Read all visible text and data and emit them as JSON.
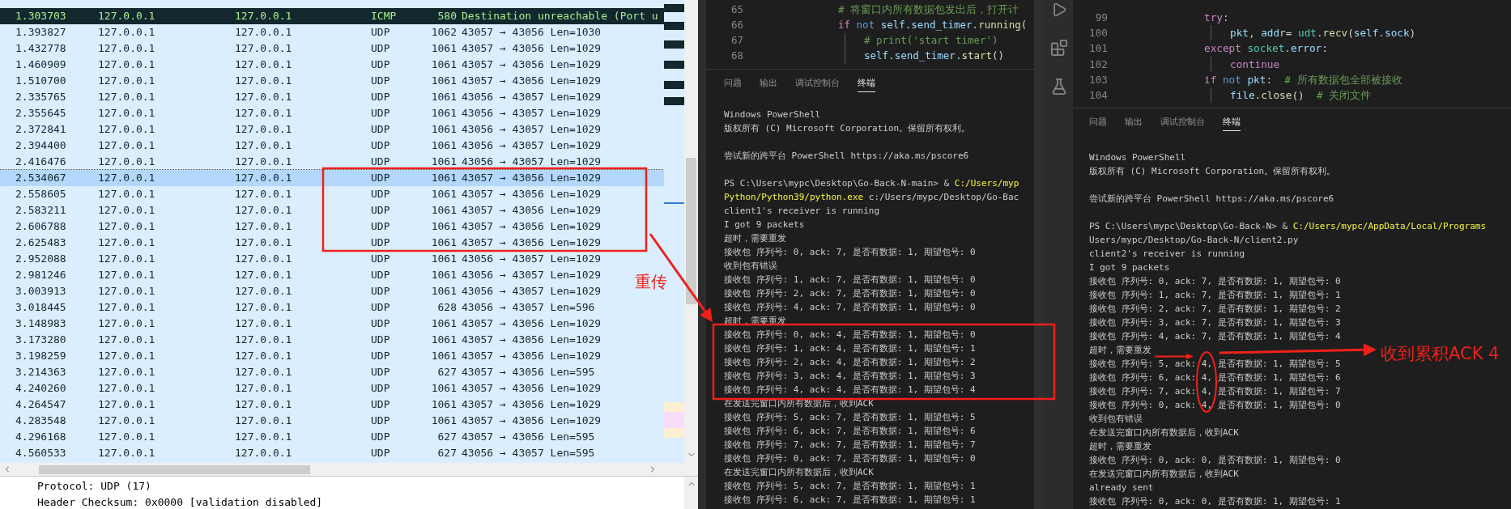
{
  "packet_list": {
    "rows": [
      {
        "time": "1.303703",
        "source": "127.0.0.1",
        "destination": "127.0.0.1",
        "protocol": "ICMP",
        "length": "580",
        "info": "Destination unreachable (Port u",
        "kind": "error",
        "selected": false
      },
      {
        "time": "1.393827",
        "source": "127.0.0.1",
        "destination": "127.0.0.1",
        "protocol": "UDP",
        "length": "1062",
        "info": "43057 → 43056 Len=1030",
        "kind": "normal",
        "selected": false
      },
      {
        "time": "1.432778",
        "source": "127.0.0.1",
        "destination": "127.0.0.1",
        "protocol": "UDP",
        "length": "1061",
        "info": "43057 → 43056 Len=1029",
        "kind": "normal",
        "selected": false
      },
      {
        "time": "1.460909",
        "source": "127.0.0.1",
        "destination": "127.0.0.1",
        "protocol": "UDP",
        "length": "1061",
        "info": "43057 → 43056 Len=1029",
        "kind": "normal",
        "selected": false
      },
      {
        "time": "1.510700",
        "source": "127.0.0.1",
        "destination": "127.0.0.1",
        "protocol": "UDP",
        "length": "1061",
        "info": "43057 → 43056 Len=1029",
        "kind": "normal",
        "selected": false
      },
      {
        "time": "2.335765",
        "source": "127.0.0.1",
        "destination": "127.0.0.1",
        "protocol": "UDP",
        "length": "1061",
        "info": "43056 → 43057 Len=1029",
        "kind": "normal",
        "selected": false
      },
      {
        "time": "2.355645",
        "source": "127.0.0.1",
        "destination": "127.0.0.1",
        "protocol": "UDP",
        "length": "1061",
        "info": "43056 → 43057 Len=1029",
        "kind": "normal",
        "selected": false
      },
      {
        "time": "2.372841",
        "source": "127.0.0.1",
        "destination": "127.0.0.1",
        "protocol": "UDP",
        "length": "1061",
        "info": "43056 → 43057 Len=1029",
        "kind": "normal",
        "selected": false
      },
      {
        "time": "2.394400",
        "source": "127.0.0.1",
        "destination": "127.0.0.1",
        "protocol": "UDP",
        "length": "1061",
        "info": "43056 → 43057 Len=1029",
        "kind": "normal",
        "selected": false
      },
      {
        "time": "2.416476",
        "source": "127.0.0.1",
        "destination": "127.0.0.1",
        "protocol": "UDP",
        "length": "1061",
        "info": "43056 → 43057 Len=1029",
        "kind": "normal",
        "selected": false
      },
      {
        "time": "2.534067",
        "source": "127.0.0.1",
        "destination": "127.0.0.1",
        "protocol": "UDP",
        "length": "1061",
        "info": "43057 → 43056 Len=1029",
        "kind": "normal",
        "selected": true
      },
      {
        "time": "2.558605",
        "source": "127.0.0.1",
        "destination": "127.0.0.1",
        "protocol": "UDP",
        "length": "1061",
        "info": "43057 → 43056 Len=1029",
        "kind": "normal",
        "selected": false
      },
      {
        "time": "2.583211",
        "source": "127.0.0.1",
        "destination": "127.0.0.1",
        "protocol": "UDP",
        "length": "1061",
        "info": "43057 → 43056 Len=1029",
        "kind": "normal",
        "selected": false
      },
      {
        "time": "2.606788",
        "source": "127.0.0.1",
        "destination": "127.0.0.1",
        "protocol": "UDP",
        "length": "1061",
        "info": "43057 → 43056 Len=1029",
        "kind": "normal",
        "selected": false
      },
      {
        "time": "2.625483",
        "source": "127.0.0.1",
        "destination": "127.0.0.1",
        "protocol": "UDP",
        "length": "1061",
        "info": "43057 → 43056 Len=1029",
        "kind": "normal",
        "selected": false
      },
      {
        "time": "2.952088",
        "source": "127.0.0.1",
        "destination": "127.0.0.1",
        "protocol": "UDP",
        "length": "1061",
        "info": "43056 → 43057 Len=1029",
        "kind": "normal",
        "selected": false
      },
      {
        "time": "2.981246",
        "source": "127.0.0.1",
        "destination": "127.0.0.1",
        "protocol": "UDP",
        "length": "1061",
        "info": "43056 → 43057 Len=1029",
        "kind": "normal",
        "selected": false
      },
      {
        "time": "3.003913",
        "source": "127.0.0.1",
        "destination": "127.0.0.1",
        "protocol": "UDP",
        "length": "1061",
        "info": "43056 → 43057 Len=1029",
        "kind": "normal",
        "selected": false
      },
      {
        "time": "3.018445",
        "source": "127.0.0.1",
        "destination": "127.0.0.1",
        "protocol": "UDP",
        "length": "628",
        "info": "43056 → 43057 Len=596",
        "kind": "normal",
        "selected": false
      },
      {
        "time": "3.148983",
        "source": "127.0.0.1",
        "destination": "127.0.0.1",
        "protocol": "UDP",
        "length": "1061",
        "info": "43057 → 43056 Len=1029",
        "kind": "normal",
        "selected": false
      },
      {
        "time": "3.173280",
        "source": "127.0.0.1",
        "destination": "127.0.0.1",
        "protocol": "UDP",
        "length": "1061",
        "info": "43057 → 43056 Len=1029",
        "kind": "normal",
        "selected": false
      },
      {
        "time": "3.198259",
        "source": "127.0.0.1",
        "destination": "127.0.0.1",
        "protocol": "UDP",
        "length": "1061",
        "info": "43057 → 43056 Len=1029",
        "kind": "normal",
        "selected": false
      },
      {
        "time": "3.214363",
        "source": "127.0.0.1",
        "destination": "127.0.0.1",
        "protocol": "UDP",
        "length": "627",
        "info": "43057 → 43056 Len=595",
        "kind": "normal",
        "selected": false
      },
      {
        "time": "4.240260",
        "source": "127.0.0.1",
        "destination": "127.0.0.1",
        "protocol": "UDP",
        "length": "1061",
        "info": "43057 → 43056 Len=1029",
        "kind": "normal",
        "selected": false
      },
      {
        "time": "4.264547",
        "source": "127.0.0.1",
        "destination": "127.0.0.1",
        "protocol": "UDP",
        "length": "1061",
        "info": "43057 → 43056 Len=1029",
        "kind": "normal",
        "selected": false
      },
      {
        "time": "4.283548",
        "source": "127.0.0.1",
        "destination": "127.0.0.1",
        "protocol": "UDP",
        "length": "1061",
        "info": "43057 → 43056 Len=1029",
        "kind": "normal",
        "selected": false
      },
      {
        "time": "4.296168",
        "source": "127.0.0.1",
        "destination": "127.0.0.1",
        "protocol": "UDP",
        "length": "627",
        "info": "43057 → 43056 Len=595",
        "kind": "normal",
        "selected": false
      },
      {
        "time": "4.560533",
        "source": "127.0.0.1",
        "destination": "127.0.0.1",
        "protocol": "UDP",
        "length": "627",
        "info": "43056 → 43057 Len=595",
        "kind": "normal",
        "selected": false
      }
    ]
  },
  "packet_details": [
    "Protocol: UDP (17)",
    "Header Checksum: 0x0000 [validation disabled]"
  ],
  "editors": [
    {
      "code_lines": [
        {
          "number": "65",
          "indented": false,
          "tokens": [
            {
              "text": "# 将窗口内所有数据包发出后，打开计",
              "kind": "comment"
            }
          ]
        },
        {
          "number": "66",
          "indented": false,
          "tokens": [
            {
              "text": "if",
              "kind": "control"
            },
            {
              "text": " not ",
              "kind": "keyword"
            },
            {
              "text": "self.send_timer.",
              "kind": "variable"
            },
            {
              "text": "running",
              "kind": "function"
            },
            {
              "text": "(",
              "kind": "plain"
            }
          ]
        },
        {
          "number": "67",
          "indented": true,
          "tokens": [
            {
              "text": "# print('start timer')",
              "kind": "comment"
            }
          ]
        },
        {
          "number": "68",
          "indented": true,
          "tokens": [
            {
              "text": "self.send_timer.",
              "kind": "variable"
            },
            {
              "text": "start",
              "kind": "function"
            },
            {
              "text": "()",
              "kind": "plain"
            }
          ]
        }
      ],
      "tabs": [
        {
          "label": "问题",
          "selected": false
        },
        {
          "label": "输出",
          "selected": false
        },
        {
          "label": "调试控制台",
          "selected": false
        },
        {
          "label": "终端",
          "selected": true
        }
      ],
      "terminal": [
        {
          "kind": "text",
          "segments": [
            {
              "text": "Windows PowerShell",
              "highlight": false
            }
          ]
        },
        {
          "kind": "text",
          "segments": [
            {
              "text": "版权所有 (C) Microsoft Corporation。保留所有权利。",
              "highlight": false
            }
          ]
        },
        {
          "kind": "blank"
        },
        {
          "kind": "text",
          "segments": [
            {
              "text": "尝试新的跨平台 PowerShell https://aka.ms/pscore6",
              "highlight": false
            }
          ]
        },
        {
          "kind": "blank"
        },
        {
          "kind": "text",
          "segments": [
            {
              "text": "PS C:\\Users\\mypc\\Desktop\\Go-Back-N-main> & ",
              "highlight": false
            },
            {
              "text": "C:/Users/myp",
              "highlight": true
            }
          ]
        },
        {
          "kind": "text",
          "segments": [
            {
              "text": "Python/Python39/python.exe",
              "highlight": true
            },
            {
              "text": " c:/Users/mypc/Desktop/Go-Bac",
              "highlight": false
            }
          ]
        },
        {
          "kind": "text",
          "segments": [
            {
              "text": "client1's receiver is running",
              "highlight": false
            }
          ]
        },
        {
          "kind": "text",
          "segments": [
            {
              "text": "I got 9 packets",
              "highlight": false
            }
          ]
        },
        {
          "kind": "text",
          "segments": [
            {
              "text": "超时，需要重发",
              "highlight": false
            }
          ]
        },
        {
          "kind": "text",
          "segments": [
            {
              "text": "接收包 序列号: 0, ack: 7, 是否有数据: 1, 期望包号: 0",
              "highlight": false
            }
          ]
        },
        {
          "kind": "text",
          "segments": [
            {
              "text": "收到包有错误",
              "highlight": false
            }
          ]
        },
        {
          "kind": "text",
          "segments": [
            {
              "text": "接收包 序列号: 1, ack: 7, 是否有数据: 1, 期望包号: 0",
              "highlight": false
            }
          ]
        },
        {
          "kind": "text",
          "segments": [
            {
              "text": "接收包 序列号: 2, ack: 7, 是否有数据: 1, 期望包号: 0",
              "highlight": false
            }
          ]
        },
        {
          "kind": "text",
          "segments": [
            {
              "text": "接收包 序列号: 4, ack: 7, 是否有数据: 1, 期望包号: 0",
              "highlight": false
            }
          ]
        },
        {
          "kind": "text",
          "segments": [
            {
              "text": "超时，需要重发",
              "highlight": false
            }
          ]
        },
        {
          "kind": "text",
          "segments": [
            {
              "text": "接收包 序列号: 0, ack: 4, 是否有数据: 1, 期望包号: 0",
              "highlight": false
            }
          ]
        },
        {
          "kind": "text",
          "segments": [
            {
              "text": "接收包 序列号: 1, ack: 4, 是否有数据: 1, 期望包号: 1",
              "highlight": false
            }
          ]
        },
        {
          "kind": "text",
          "segments": [
            {
              "text": "接收包 序列号: 2, ack: 4, 是否有数据: 1, 期望包号: 2",
              "highlight": false
            }
          ]
        },
        {
          "kind": "text",
          "segments": [
            {
              "text": "接收包 序列号: 3, ack: 4, 是否有数据: 1, 期望包号: 3",
              "highlight": false
            }
          ]
        },
        {
          "kind": "text",
          "segments": [
            {
              "text": "接收包 序列号: 4, ack: 4, 是否有数据: 1, 期望包号: 4",
              "highlight": false
            }
          ]
        },
        {
          "kind": "text",
          "segments": [
            {
              "text": "在发送完窗口内所有数据后，收到ACK",
              "highlight": false
            }
          ]
        },
        {
          "kind": "text",
          "segments": [
            {
              "text": "接收包 序列号: 5, ack: 7, 是否有数据: 1, 期望包号: 5",
              "highlight": false
            }
          ]
        },
        {
          "kind": "text",
          "segments": [
            {
              "text": "接收包 序列号: 6, ack: 7, 是否有数据: 1, 期望包号: 6",
              "highlight": false
            }
          ]
        },
        {
          "kind": "text",
          "segments": [
            {
              "text": "接收包 序列号: 7, ack: 7, 是否有数据: 1, 期望包号: 7",
              "highlight": false
            }
          ]
        },
        {
          "kind": "text",
          "segments": [
            {
              "text": "接收包 序列号: 0, ack: 7, 是否有数据: 1, 期望包号: 0",
              "highlight": false
            }
          ]
        },
        {
          "kind": "text",
          "segments": [
            {
              "text": "在发送完窗口内所有数据后，收到ACK",
              "highlight": false
            }
          ]
        },
        {
          "kind": "text",
          "segments": [
            {
              "text": "接收包 序列号: 5, ack: 7, 是否有数据: 1, 期望包号: 1",
              "highlight": false
            }
          ]
        },
        {
          "kind": "text",
          "segments": [
            {
              "text": "接收包 序列号: 6, ack: 7, 是否有数据: 1, 期望包号: 1",
              "highlight": false
            }
          ]
        }
      ]
    },
    {
      "code_lines": [
        {
          "number": "99",
          "indented": false,
          "tokens": [
            {
              "text": "try",
              "kind": "control"
            },
            {
              "text": ":",
              "kind": "plain"
            }
          ]
        },
        {
          "number": "100",
          "indented": true,
          "tokens": [
            {
              "text": "pkt",
              "kind": "variable"
            },
            {
              "text": ", ",
              "kind": "plain"
            },
            {
              "text": "addr",
              "kind": "variable"
            },
            {
              "text": "= ",
              "kind": "plain"
            },
            {
              "text": "udt",
              "kind": "type"
            },
            {
              "text": ".",
              "kind": "plain"
            },
            {
              "text": "recv",
              "kind": "function"
            },
            {
              "text": "(",
              "kind": "plain"
            },
            {
              "text": "self.sock",
              "kind": "variable"
            },
            {
              "text": ")",
              "kind": "plain"
            }
          ]
        },
        {
          "number": "101",
          "indented": false,
          "tokens": [
            {
              "text": "except ",
              "kind": "control"
            },
            {
              "text": "socket",
              "kind": "type"
            },
            {
              "text": ".",
              "kind": "plain"
            },
            {
              "text": "error",
              "kind": "variable"
            },
            {
              "text": ":",
              "kind": "plain"
            }
          ]
        },
        {
          "number": "102",
          "indented": true,
          "tokens": [
            {
              "text": "continue",
              "kind": "control"
            }
          ]
        },
        {
          "number": "103",
          "indented": false,
          "tokens": [
            {
              "text": "if",
              "kind": "control"
            },
            {
              "text": " not ",
              "kind": "keyword"
            },
            {
              "text": "pkt",
              "kind": "variable"
            },
            {
              "text": ":  ",
              "kind": "plain"
            },
            {
              "text": "# 所有数据包全部被接收",
              "kind": "comment"
            }
          ]
        },
        {
          "number": "104",
          "indented": true,
          "tokens": [
            {
              "text": "file",
              "kind": "variable"
            },
            {
              "text": ".",
              "kind": "plain"
            },
            {
              "text": "close",
              "kind": "function"
            },
            {
              "text": "()  ",
              "kind": "plain"
            },
            {
              "text": "# 关闭文件",
              "kind": "comment"
            }
          ]
        }
      ],
      "tabs": [
        {
          "label": "问题",
          "selected": false
        },
        {
          "label": "输出",
          "selected": false
        },
        {
          "label": "调试控制台",
          "selected": false
        },
        {
          "label": "终端",
          "selected": true
        }
      ],
      "terminal": [
        {
          "kind": "text",
          "segments": [
            {
              "text": "Windows PowerShell",
              "highlight": false
            }
          ]
        },
        {
          "kind": "text",
          "segments": [
            {
              "text": "版权所有 (C) Microsoft Corporation。保留所有权利。",
              "highlight": false
            }
          ]
        },
        {
          "kind": "blank"
        },
        {
          "kind": "text",
          "segments": [
            {
              "text": "尝试新的跨平台 PowerShell https://aka.ms/pscore6",
              "highlight": false
            }
          ]
        },
        {
          "kind": "blank"
        },
        {
          "kind": "text",
          "segments": [
            {
              "text": "PS C:\\Users\\mypc\\Desktop\\Go-Back-N> & ",
              "highlight": false
            },
            {
              "text": "C:/Users/mypc/AppData/Local/Programs",
              "highlight": true
            }
          ]
        },
        {
          "kind": "text",
          "segments": [
            {
              "text": "Users/mypc/Desktop/Go-Back-N/client2.py",
              "highlight": false
            }
          ]
        },
        {
          "kind": "text",
          "segments": [
            {
              "text": "client2's receiver is running",
              "highlight": false
            }
          ]
        },
        {
          "kind": "text",
          "segments": [
            {
              "text": "I got 9 packets",
              "highlight": false
            }
          ]
        },
        {
          "kind": "text",
          "segments": [
            {
              "text": "接收包 序列号: 0, ack: 7, 是否有数据: 1, 期望包号: 0",
              "highlight": false
            }
          ]
        },
        {
          "kind": "text",
          "segments": [
            {
              "text": "接收包 序列号: 1, ack: 7, 是否有数据: 1, 期望包号: 1",
              "highlight": false
            }
          ]
        },
        {
          "kind": "text",
          "segments": [
            {
              "text": "接收包 序列号: 2, ack: 7, 是否有数据: 1, 期望包号: 2",
              "highlight": false
            }
          ]
        },
        {
          "kind": "text",
          "segments": [
            {
              "text": "接收包 序列号: 3, ack: 7, 是否有数据: 1, 期望包号: 3",
              "highlight": false
            }
          ]
        },
        {
          "kind": "text",
          "segments": [
            {
              "text": "接收包 序列号: 4, ack: 7, 是否有数据: 1, 期望包号: 4",
              "highlight": false
            }
          ]
        },
        {
          "kind": "text",
          "segments": [
            {
              "text": "超时，需要重发",
              "highlight": false
            }
          ]
        },
        {
          "kind": "text",
          "segments": [
            {
              "text": "接收包 序列号: 5, ack: 4, 是否有数据: 1, 期望包号: 5",
              "highlight": false
            }
          ]
        },
        {
          "kind": "text",
          "segments": [
            {
              "text": "接收包 序列号: 6, ack: 4, 是否有数据: 1, 期望包号: 6",
              "highlight": false
            }
          ]
        },
        {
          "kind": "text",
          "segments": [
            {
              "text": "接收包 序列号: 7, ack: 4, 是否有数据: 1, 期望包号: 7",
              "highlight": false
            }
          ]
        },
        {
          "kind": "text",
          "segments": [
            {
              "text": "接收包 序列号: 0, ack: 4, 是否有数据: 1, 期望包号: 0",
              "highlight": false
            }
          ]
        },
        {
          "kind": "text",
          "segments": [
            {
              "text": "收到包有错误",
              "highlight": false
            }
          ]
        },
        {
          "kind": "text",
          "segments": [
            {
              "text": "在发送完窗口内所有数据后，收到ACK",
              "highlight": false
            }
          ]
        },
        {
          "kind": "text",
          "segments": [
            {
              "text": "超时，需要重发",
              "highlight": false
            }
          ]
        },
        {
          "kind": "text",
          "segments": [
            {
              "text": "接收包 序列号: 0, ack: 0, 是否有数据: 1, 期望包号: 0",
              "highlight": false
            }
          ]
        },
        {
          "kind": "text",
          "segments": [
            {
              "text": "在发送完窗口内所有数据后，收到ACK",
              "highlight": false
            }
          ]
        },
        {
          "kind": "text",
          "segments": [
            {
              "text": "already sent",
              "highlight": false
            }
          ]
        },
        {
          "kind": "text",
          "segments": [
            {
              "text": "接收包 序列号: 0, ack: 0, 是否有数据: 1, 期望包号: 1",
              "highlight": false
            }
          ]
        }
      ]
    }
  ],
  "annotations": {
    "retransmit_label": "重传",
    "cumulative_ack_label": "收到累积ACK 4"
  }
}
